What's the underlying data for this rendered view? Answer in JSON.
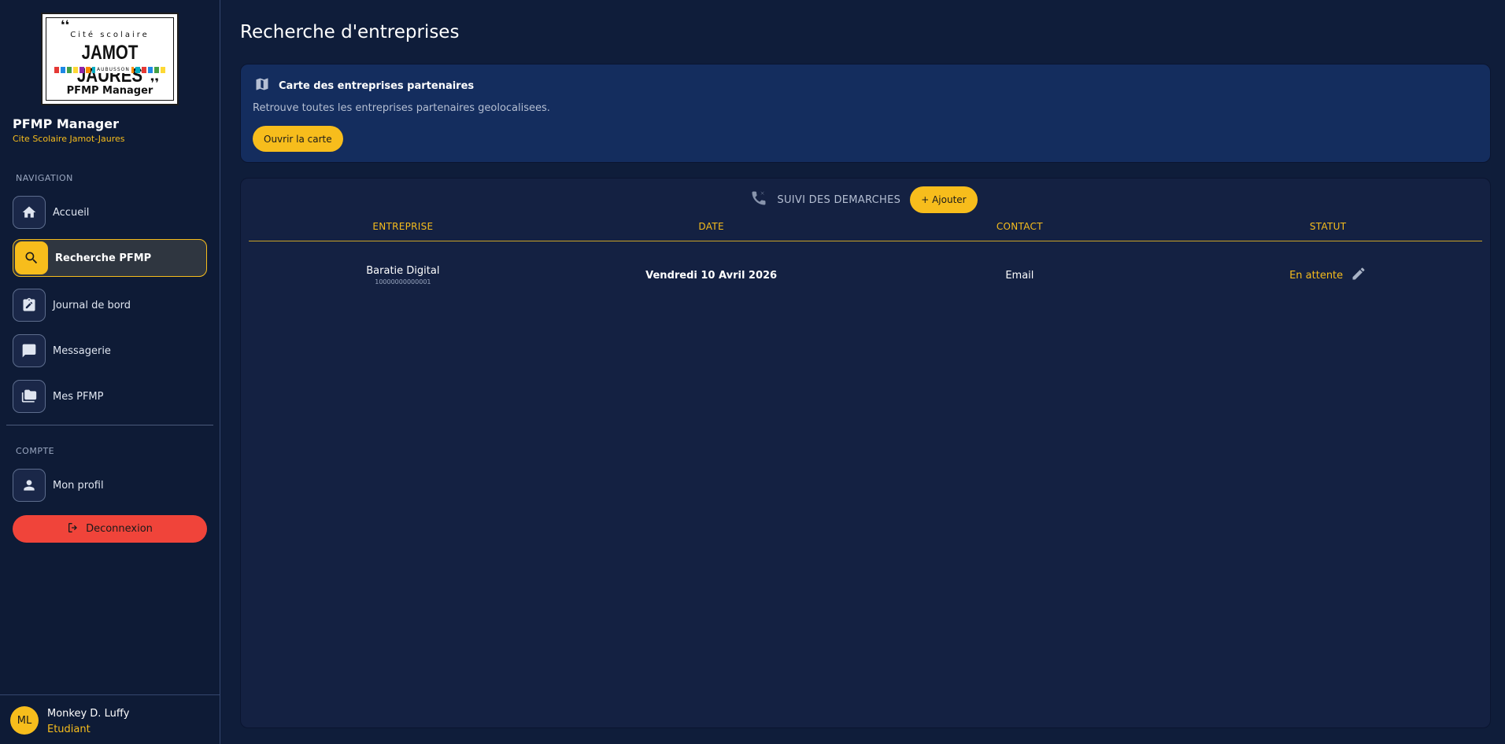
{
  "logo": {
    "line1": "Cité scolaire",
    "line2": "JAMOT JAURES",
    "line3": "AUBUSSON",
    "line4": "PFMP Manager",
    "bar_colors": [
      "#e53935",
      "#1e88e5",
      "#43a047",
      "#fdd835",
      "#8e24aa",
      "#fb8c00",
      "#00acc1",
      "#e53935",
      "#1e88e5",
      "#43a047",
      "#fdd835",
      "#8e24aa",
      "#fb8c00",
      "#00acc1",
      "#e53935",
      "#1e88e5",
      "#43a047",
      "#fdd835"
    ]
  },
  "sidebar": {
    "app_name": "PFMP Manager",
    "school": "Cite Scolaire Jamot-Jaures",
    "nav_section": "NAVIGATION",
    "nav_items": [
      {
        "label": "Accueil",
        "icon": "home-icon"
      },
      {
        "label": "Recherche PFMP",
        "icon": "search-icon",
        "active": true
      },
      {
        "label": "Journal de bord",
        "icon": "clipboard-edit-icon"
      },
      {
        "label": "Messagerie",
        "icon": "chat-icon"
      },
      {
        "label": "Mes PFMP",
        "icon": "folders-icon"
      }
    ],
    "account_section": "COMPTE",
    "account_items": [
      {
        "label": "Mon profil",
        "icon": "person-icon"
      }
    ],
    "logout_label": "Deconnexion"
  },
  "user": {
    "initials": "ML",
    "name": "Monkey D. Luffy",
    "role": "Etudiant"
  },
  "main": {
    "title": "Recherche d'entreprises",
    "map_card": {
      "title": "Carte des entreprises partenaires",
      "description": "Retrouve toutes les entreprises partenaires geolocalisees.",
      "button": "Ouvrir la carte"
    },
    "tracking": {
      "title": "SUIVI DES DEMARCHES",
      "add_button": "+ Ajouter",
      "columns": [
        "ENTREPRISE",
        "DATE",
        "CONTACT",
        "STATUT"
      ],
      "rows": [
        {
          "company": "Baratie Digital",
          "siret": "10000000000001",
          "date": "Vendredi 10 Avril 2026",
          "contact": "Email",
          "status": "En attente"
        }
      ]
    }
  },
  "colors": {
    "accent": "#f7bd1c",
    "danger": "#f0443a",
    "background": "#0f1d3a"
  }
}
